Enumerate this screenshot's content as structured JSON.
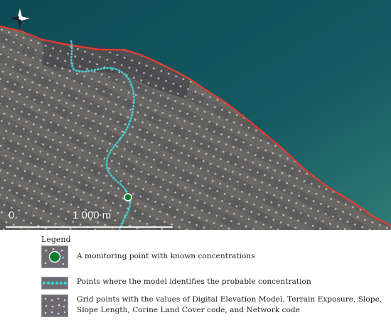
{
  "map": {
    "scale_start": "0",
    "scale_end": "1 000 m",
    "compass": "north-arrow",
    "colors": {
      "sea_deep": "#0f4b57",
      "sea_shallow": "#2f7c78",
      "land": "#6d6a70",
      "coastline": "#e63b2f",
      "river_points": "#3fd2d6",
      "grid_points": "#d9d2de",
      "monitoring_point": "#0e7d2b"
    }
  },
  "legend": {
    "title": "Legend",
    "items": [
      {
        "icon": "monitoring-point-swatch",
        "text": "A monitoring point with known concentrations"
      },
      {
        "icon": "model-points-swatch",
        "text": "Points where the model identifies the probable concentration"
      },
      {
        "icon": "grid-points-swatch",
        "text": "Grid points with the values of Digital Elevation Model, Terrain Exposure, Slope, Slope Length, Corine Land Cover code, and Network code"
      }
    ]
  }
}
